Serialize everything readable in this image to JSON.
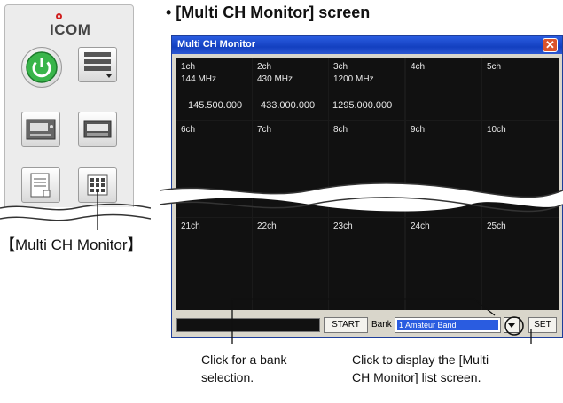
{
  "launcher": {
    "logo": "ICOM",
    "caption": "【Multi CH Monitor】"
  },
  "heading": "• [Multi CH Monitor] screen",
  "window": {
    "title": "Multi CH Monitor",
    "close_icon": "close-icon"
  },
  "channels": [
    {
      "name": "1ch",
      "band": "144 MHz",
      "freq": "145.500.000"
    },
    {
      "name": "2ch",
      "band": "430 MHz",
      "freq": "433.000.000"
    },
    {
      "name": "3ch",
      "band": "1200 MHz",
      "freq": "1295.000.000"
    },
    {
      "name": "4ch"
    },
    {
      "name": "5ch"
    },
    {
      "name": "6ch"
    },
    {
      "name": "7ch"
    },
    {
      "name": "8ch"
    },
    {
      "name": "9ch"
    },
    {
      "name": "10ch"
    },
    {
      "name": "21ch"
    },
    {
      "name": "22ch"
    },
    {
      "name": "23ch"
    },
    {
      "name": "24ch"
    },
    {
      "name": "25ch"
    }
  ],
  "bottom_bar": {
    "start": "START",
    "bank_label": "Bank",
    "bank_value": "1  Amateur Band",
    "set": "SET"
  },
  "annotations": {
    "bank_select": [
      "Click for a bank",
      "selection."
    ],
    "list_button": [
      "Click to display the [Multi",
      "CH Monitor] list screen."
    ]
  },
  "colors": {
    "titlebar": "#1340c0",
    "close": "#d9532b",
    "grid_bg": "#111111",
    "power_green": "#39b54a"
  }
}
